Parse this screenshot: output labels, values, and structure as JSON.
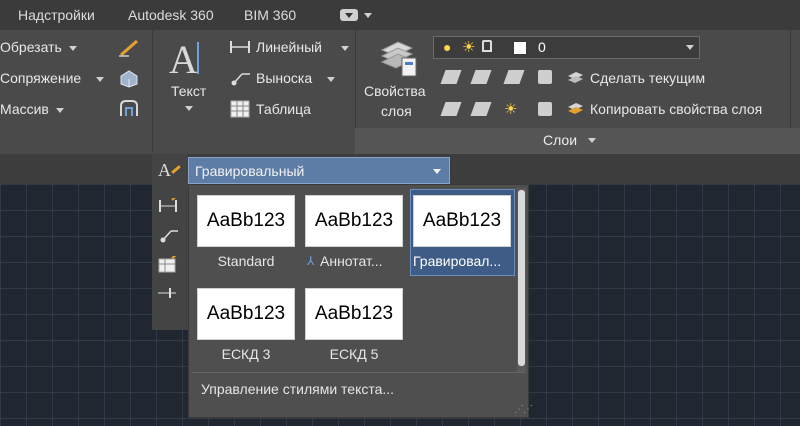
{
  "tabs": [
    "Надстройки",
    "Autodesk 360",
    "BIM 360"
  ],
  "ribbon": {
    "modify": {
      "trim": "Обрезать",
      "fillet": "Сопряжение",
      "array": "Массив"
    },
    "annotation": {
      "text": "Текст",
      "linear": "Линейный",
      "leader": "Выноска",
      "table": "Таблица"
    },
    "layers": {
      "layer_props_line1": "Свойства",
      "layer_props_line2": "слоя",
      "current_layer": "0",
      "make_current": "Сделать текущим",
      "match_layer": "Копировать свойства слоя",
      "panel_label": "Слои"
    }
  },
  "text_style": {
    "selected": "Гравировальный",
    "preview_text": "AaBb123",
    "styles": [
      "Standard",
      "Аннотат...",
      "Гравировал...",
      "ЕСКД 3",
      "ЕСКД 5"
    ],
    "manage_label": "Управление стилями текста..."
  },
  "colors": {
    "accent": "#5d7ca6",
    "selection": "#3f5c86",
    "ribbon_bg": "#4a4a4a",
    "canvas_bg": "#212730"
  }
}
